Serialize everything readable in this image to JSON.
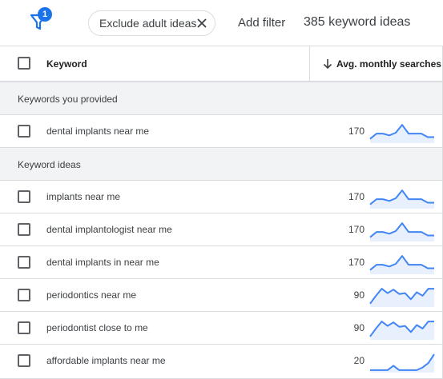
{
  "toolbar": {
    "filter_badge": "1",
    "chip_label": "Exclude adult ideas",
    "add_filter": "Add filter",
    "keyword_count": "385 keyword ideas"
  },
  "table": {
    "header_keyword": "Keyword",
    "header_avg": "Avg. monthly searches"
  },
  "sections": {
    "provided": "Keywords you provided",
    "ideas": "Keyword ideas"
  },
  "colors": {
    "accent": "#1a73e8",
    "trend_line": "#4285f4",
    "trend_fill": "#e8f0fe"
  },
  "rows": [
    {
      "keyword": "dental implants near me",
      "volume": "170",
      "trend": [
        0.15,
        0.45,
        0.45,
        0.35,
        0.5,
        0.95,
        0.45,
        0.45,
        0.45,
        0.25,
        0.25
      ]
    },
    {
      "keyword": "implants near me",
      "volume": "170",
      "trend": [
        0.15,
        0.45,
        0.45,
        0.35,
        0.5,
        0.95,
        0.45,
        0.45,
        0.45,
        0.25,
        0.25
      ]
    },
    {
      "keyword": "dental implantologist near me",
      "volume": "170",
      "trend": [
        0.15,
        0.45,
        0.45,
        0.35,
        0.5,
        0.95,
        0.45,
        0.45,
        0.45,
        0.25,
        0.25
      ]
    },
    {
      "keyword": "dental implants in near me",
      "volume": "170",
      "trend": [
        0.15,
        0.45,
        0.45,
        0.35,
        0.5,
        0.95,
        0.45,
        0.45,
        0.45,
        0.25,
        0.25
      ]
    },
    {
      "keyword": "periodontics near me",
      "volume": "90",
      "trend": [
        0.1,
        0.55,
        0.95,
        0.7,
        0.9,
        0.65,
        0.7,
        0.35,
        0.75,
        0.55,
        0.95,
        0.95
      ]
    },
    {
      "keyword": "periodontist close to me",
      "volume": "90",
      "trend": [
        0.1,
        0.55,
        0.95,
        0.7,
        0.9,
        0.65,
        0.7,
        0.35,
        0.75,
        0.55,
        0.95,
        0.95
      ]
    },
    {
      "keyword": "affordable implants near me",
      "volume": "20",
      "trend": [
        0.05,
        0.05,
        0.05,
        0.05,
        0.3,
        0.05,
        0.05,
        0.05,
        0.05,
        0.2,
        0.45,
        0.95
      ]
    }
  ]
}
